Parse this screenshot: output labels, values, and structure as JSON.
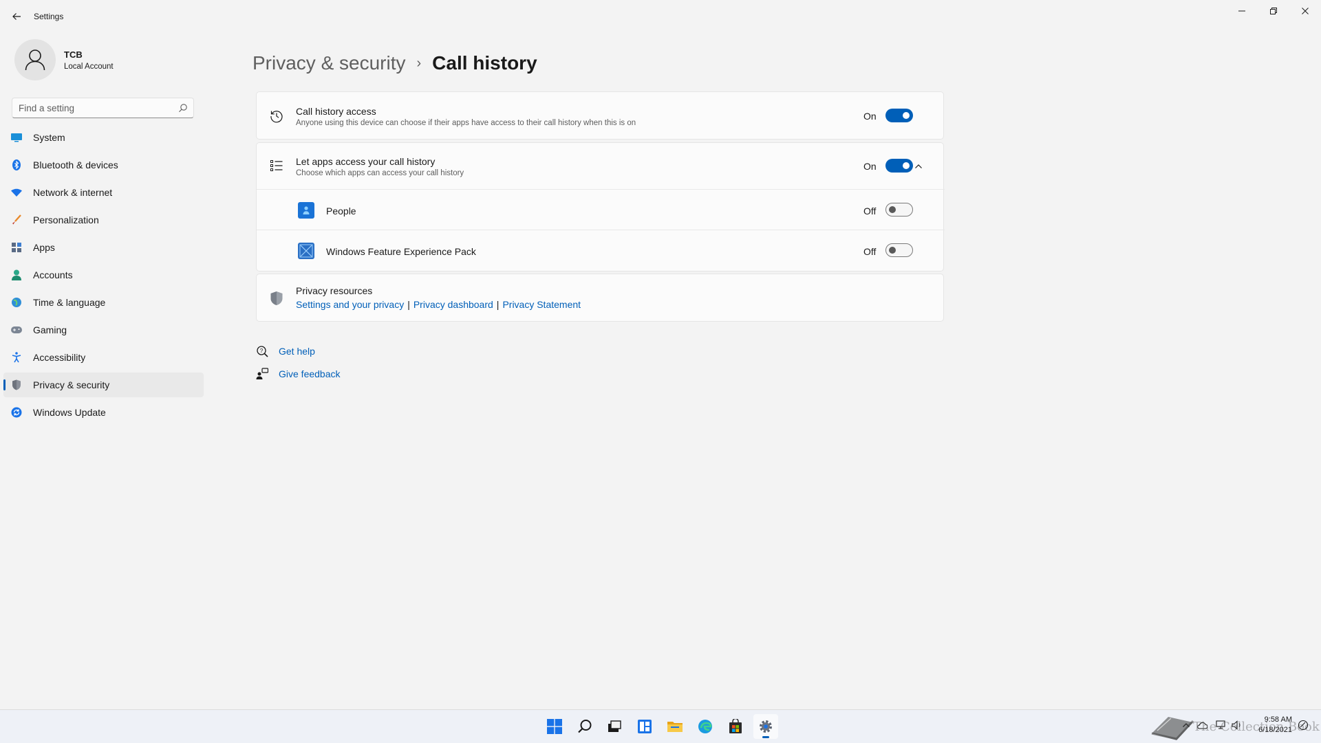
{
  "window": {
    "app_title": "Settings"
  },
  "account": {
    "name": "TCB",
    "type": "Local Account"
  },
  "search": {
    "placeholder": "Find a setting"
  },
  "nav": [
    {
      "label": "System",
      "icon": "system-icon"
    },
    {
      "label": "Bluetooth & devices",
      "icon": "bluetooth-icon"
    },
    {
      "label": "Network & internet",
      "icon": "wifi-icon"
    },
    {
      "label": "Personalization",
      "icon": "brush-icon"
    },
    {
      "label": "Apps",
      "icon": "apps-icon"
    },
    {
      "label": "Accounts",
      "icon": "person-icon"
    },
    {
      "label": "Time & language",
      "icon": "globe-icon"
    },
    {
      "label": "Gaming",
      "icon": "gamepad-icon"
    },
    {
      "label": "Accessibility",
      "icon": "accessibility-icon"
    },
    {
      "label": "Privacy & security",
      "icon": "shield-icon",
      "selected": true
    },
    {
      "label": "Windows Update",
      "icon": "update-icon"
    }
  ],
  "breadcrumb": {
    "parent": "Privacy & security",
    "separator": "›",
    "current": "Call history"
  },
  "call_history_access": {
    "title": "Call history access",
    "description": "Anyone using this device can choose if their apps have access to their call history when this is on",
    "state": "On",
    "enabled": true
  },
  "app_access": {
    "title": "Let apps access your call history",
    "description": "Choose which apps can access your call history",
    "state": "On",
    "enabled": true,
    "expanded": true,
    "apps": [
      {
        "name": "People",
        "state": "Off",
        "enabled": false,
        "icon": "people-app-icon"
      },
      {
        "name": "Windows Feature Experience Pack",
        "state": "Off",
        "enabled": false,
        "icon": "feature-pack-icon"
      }
    ]
  },
  "privacy_resources": {
    "title": "Privacy resources",
    "links": [
      "Settings and your privacy",
      "Privacy dashboard",
      "Privacy Statement"
    ],
    "separator": "|"
  },
  "help": {
    "get_help": "Get help",
    "give_feedback": "Give feedback"
  },
  "taskbar": {
    "time": "9:58 AM",
    "date": "6/18/2021",
    "watermark": "The Collection Book",
    "apps": [
      "start-icon",
      "search-icon",
      "task-view-icon",
      "widgets-icon",
      "file-explorer-icon",
      "edge-icon",
      "store-icon",
      "settings-icon"
    ]
  },
  "colors": {
    "accent": "#005fb8",
    "background": "#f3f3f3",
    "card": "#fbfbfb"
  }
}
